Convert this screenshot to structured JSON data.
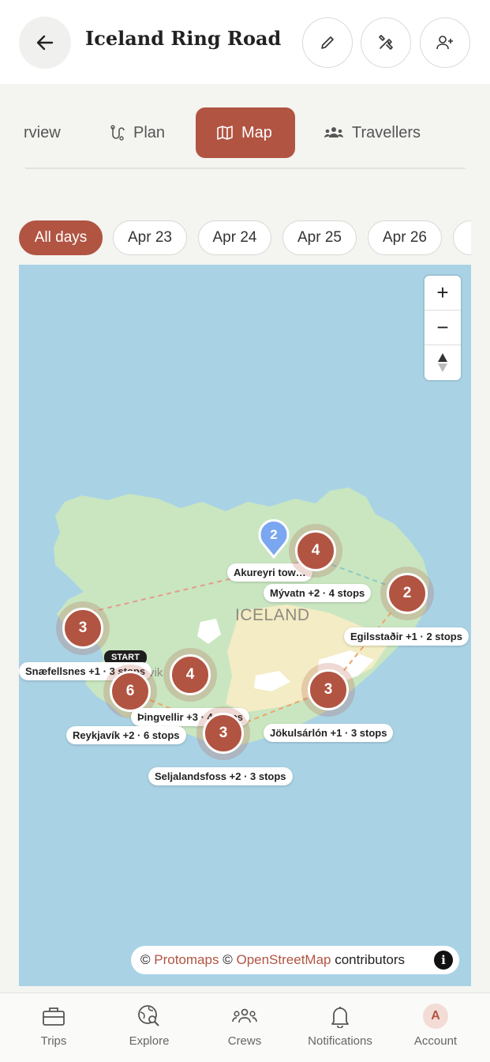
{
  "header": {
    "title": "Iceland Ring Road",
    "back_icon": "arrow-left-icon",
    "actions": [
      "pencil-icon",
      "tools-icon",
      "add-user-icon"
    ]
  },
  "tabs": [
    {
      "label": "rview",
      "icon": "overview-icon"
    },
    {
      "label": "Plan",
      "icon": "route-icon"
    },
    {
      "label": "Map",
      "icon": "map-icon",
      "active": true
    },
    {
      "label": "Travellers",
      "icon": "people-icon"
    }
  ],
  "day_chips": [
    "All days",
    "Apr 23",
    "Apr 24",
    "Apr 25",
    "Apr 26"
  ],
  "map": {
    "country_label": "ICELAND",
    "zoom_in": "+",
    "zoom_out": "−",
    "compass": "compass-icon",
    "start_badge": "START",
    "pin_count": "2",
    "partial_city_text": "vik",
    "clusters": [
      {
        "count": "4",
        "label": "Mývatn +2 · 4 stops"
      },
      {
        "count": "2",
        "label": "Egilsstaðir +1 · 2 stops"
      },
      {
        "count": "3",
        "label": "Snæfellsnes +1 · 3 stops"
      },
      {
        "count": "6",
        "label": "Reykjavík +2 · 6 stops"
      },
      {
        "count": "4",
        "label": "Þingvellir +3 · 4 stops"
      },
      {
        "count": "3",
        "label": "Seljalandsfoss +2 · 3 stops"
      },
      {
        "count": "3",
        "label": "Jökulsárlón +1 · 3 stops"
      }
    ],
    "pin_label": "Akureyri tow…",
    "attribution": {
      "prefix": "©",
      "link1": "Protomaps",
      "mid": "©",
      "link2": "OpenStreetMap",
      "suffix": "contributors"
    },
    "colors": {
      "accent": "#b15442",
      "water": "#a9d3e5",
      "land": "#c9e6c1",
      "pin": "#7aa7ef"
    }
  },
  "bottom_nav": [
    {
      "label": "Trips",
      "icon": "briefcase-icon"
    },
    {
      "label": "Explore",
      "icon": "globe-search-icon"
    },
    {
      "label": "Crews",
      "icon": "people-icon"
    },
    {
      "label": "Notifications",
      "icon": "bell-icon"
    },
    {
      "label": "Account",
      "icon": "avatar",
      "initial": "A"
    }
  ]
}
